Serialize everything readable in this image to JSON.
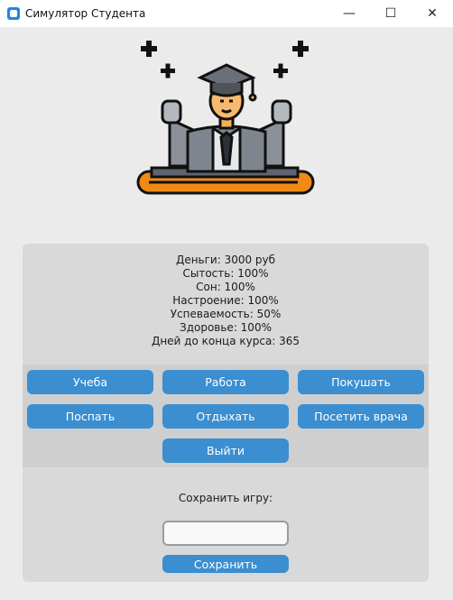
{
  "window": {
    "title": "Симулятор Студента",
    "minimize_icon": "—",
    "maximize_icon": "☐",
    "close_icon": "✕"
  },
  "stats": {
    "money": "Деньги: 3000 руб",
    "satiety": "Сытость: 100%",
    "sleep": "Сон: 100%",
    "mood": "Настроение: 100%",
    "progress": "Успеваемость: 50%",
    "health": "Здоровье: 100%",
    "days_left": "Дней до конца курса: 365"
  },
  "actions": {
    "study": "Учеба",
    "work": "Работа",
    "eat": "Покушать",
    "sleep": "Поспать",
    "rest": "Отдыхать",
    "doctor": "Посетить врача",
    "exit": "Выйти"
  },
  "save": {
    "label": "Сохранить игру:",
    "input_value": "",
    "button": "Сохранить"
  },
  "colors": {
    "accent": "#3b8ed0",
    "panel": "#d9d9d9",
    "background": "#ebebeb"
  }
}
